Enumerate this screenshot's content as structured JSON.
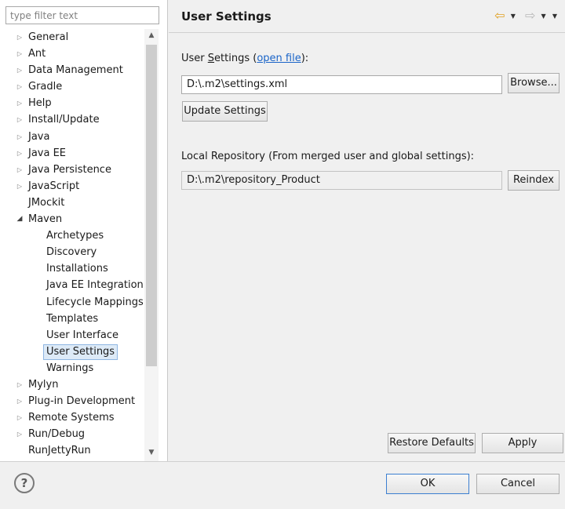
{
  "filter": {
    "placeholder": "type filter text",
    "value": ""
  },
  "tree": [
    {
      "label": "General",
      "expandable": true,
      "expanded": false,
      "depth": 0
    },
    {
      "label": "Ant",
      "expandable": true,
      "expanded": false,
      "depth": 0
    },
    {
      "label": "Data Management",
      "expandable": true,
      "expanded": false,
      "depth": 0
    },
    {
      "label": "Gradle",
      "expandable": true,
      "expanded": false,
      "depth": 0
    },
    {
      "label": "Help",
      "expandable": true,
      "expanded": false,
      "depth": 0
    },
    {
      "label": "Install/Update",
      "expandable": true,
      "expanded": false,
      "depth": 0
    },
    {
      "label": "Java",
      "expandable": true,
      "expanded": false,
      "depth": 0
    },
    {
      "label": "Java EE",
      "expandable": true,
      "expanded": false,
      "depth": 0
    },
    {
      "label": "Java Persistence",
      "expandable": true,
      "expanded": false,
      "depth": 0
    },
    {
      "label": "JavaScript",
      "expandable": true,
      "expanded": false,
      "depth": 0
    },
    {
      "label": "JMockit",
      "expandable": false,
      "expanded": false,
      "depth": 0
    },
    {
      "label": "Maven",
      "expandable": true,
      "expanded": true,
      "depth": 0
    },
    {
      "label": "Archetypes",
      "expandable": false,
      "depth": 1
    },
    {
      "label": "Discovery",
      "expandable": false,
      "depth": 1
    },
    {
      "label": "Installations",
      "expandable": false,
      "depth": 1
    },
    {
      "label": "Java EE Integration",
      "expandable": false,
      "depth": 1
    },
    {
      "label": "Lifecycle Mappings",
      "expandable": false,
      "depth": 1
    },
    {
      "label": "Templates",
      "expandable": false,
      "depth": 1
    },
    {
      "label": "User Interface",
      "expandable": false,
      "depth": 1
    },
    {
      "label": "User Settings",
      "expandable": false,
      "depth": 1,
      "selected": true
    },
    {
      "label": "Warnings",
      "expandable": false,
      "depth": 1
    },
    {
      "label": "Mylyn",
      "expandable": true,
      "expanded": false,
      "depth": 0
    },
    {
      "label": "Plug-in Development",
      "expandable": true,
      "expanded": false,
      "depth": 0
    },
    {
      "label": "Remote Systems",
      "expandable": true,
      "expanded": false,
      "depth": 0
    },
    {
      "label": "Run/Debug",
      "expandable": true,
      "expanded": false,
      "depth": 0
    },
    {
      "label": "RunJettyRun",
      "expandable": false,
      "expanded": false,
      "depth": 0
    }
  ],
  "page": {
    "title": "User Settings",
    "user_settings_prefix": "User ",
    "user_settings_mnemonic": "S",
    "user_settings_rest": "ettings (",
    "open_file_label": "open file",
    "user_settings_suffix": "):",
    "user_settings_path": "D:\\.m2\\settings.xml",
    "browse_label": "Browse...",
    "update_settings_label": "Update Settings",
    "local_repo_label": "Local Repository (From merged user and global settings):",
    "local_repo_path": "D:\\.m2\\repository_Product",
    "reindex_label": "Reindex",
    "restore_defaults_label": "Restore Defaults",
    "apply_label": "Apply"
  },
  "dialog": {
    "help_glyph": "?",
    "ok_label": "OK",
    "cancel_label": "Cancel"
  },
  "icons": {
    "back": "back-arrow-icon",
    "forward": "forward-arrow-icon",
    "menu": "view-menu-icon",
    "help": "help-icon"
  },
  "colors": {
    "link": "#1a64c8",
    "selection_fill": "#ddeaf7",
    "selection_border": "#8fb6e2",
    "back_arrow": "#e0a020",
    "default_button_border": "#3c7fd1"
  }
}
